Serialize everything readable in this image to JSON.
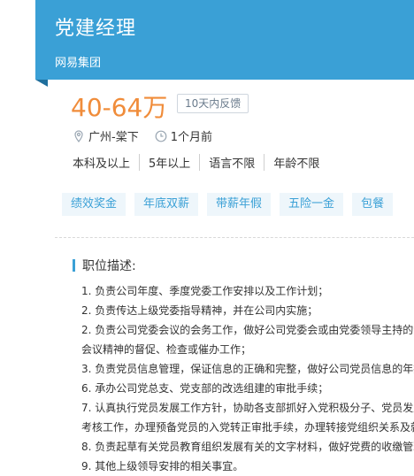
{
  "header": {
    "title": "党建经理",
    "company": "网易集团"
  },
  "job": {
    "salary": "40-64万",
    "feedback": "10天内反馈",
    "location": "广州-棠下",
    "posted": "1个月前",
    "requirements": [
      "本科及以上",
      "5年以上",
      "语言不限",
      "年龄不限"
    ],
    "benefits": [
      "绩效奖金",
      "年底双薪",
      "带薪年假",
      "五险一金",
      "包餐"
    ]
  },
  "description": {
    "title": "职位描述:",
    "lines": [
      "1. 负责公司年度、季度党委工作安排以及工作计划；",
      "2. 负责传达上级党委指导精神，并在公司内实施；",
      "2. 负责公司党委会议的会务工作，做好公司党委会或由党委领导主持的会",
      "会议精神的督促、检查或催办工作；",
      "3. 负责党员信息管理，保证信息的正确和完整，做好公司党员信息的年报",
      "6. 承办公司党总支、党支部的改选组建的审批手续；",
      "7. 认真执行党员发展工作方针，协助各支部抓好入党积极分子、党员发展",
      "考核工作，办理预备党员的入党转正审批手续，办理转接党组织关系及就",
      "8. 负责起草有关党员教育组织发展有关的文字材料，做好党费的收缴管理",
      "9. 其他上级领导安排的相关事宜。"
    ]
  },
  "colors": {
    "header_bg": "#3aa0d6",
    "salary": "#f08c3a",
    "tag_text": "#3aa0d6"
  }
}
